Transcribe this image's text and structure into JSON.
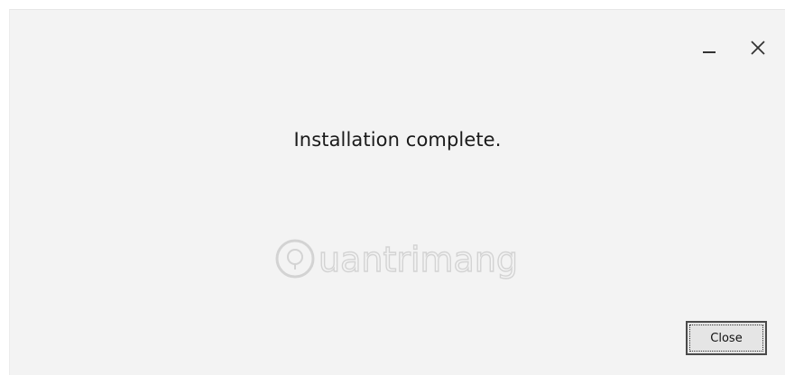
{
  "window": {
    "message": "Installation complete.",
    "close_button_label": "Close"
  },
  "controls": {
    "minimize_icon": "minimize-icon",
    "close_icon": "close-icon"
  },
  "watermark": {
    "text": "uantrimang"
  },
  "colors": {
    "window_bg": "#f3f3f3",
    "text": "#1a1a1a",
    "button_border": "#4a4a4a"
  }
}
